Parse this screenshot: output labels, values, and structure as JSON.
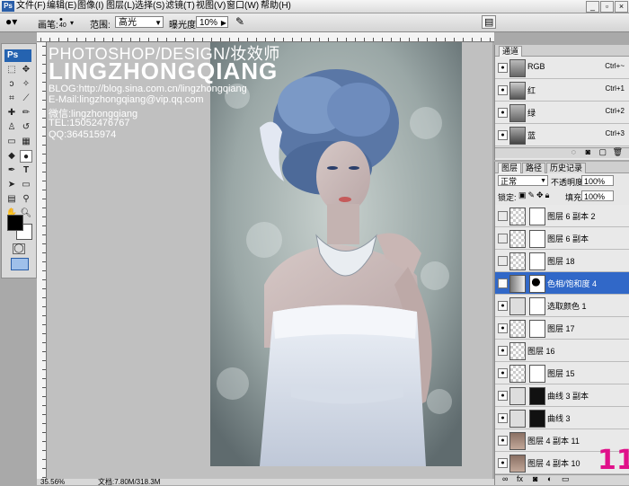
{
  "menubar": {
    "items": [
      "文件(F)",
      "编辑(E)",
      "图像(I)",
      "图层(L)",
      "选择(S)",
      "滤镜(T)",
      "视图(V)",
      "窗口(W)",
      "帮助(H)"
    ]
  },
  "options": {
    "brush_label": "画笔:",
    "brush_size": "40",
    "range_label": "范围:",
    "range_value": "高光",
    "exposure_label": "曝光度:",
    "exposure_value": "10%"
  },
  "overlay": {
    "line1": "PHOTOSHOP/DESIGN/妆效师",
    "line2": "LINGZHONGQIANG",
    "blog": "BLOG:http://blog.sina.com.cn/lingzhongqiang",
    "email": "E-Mail:lingzhongqiang@vip.qq.com",
    "wechat": "微信:lingzhongqiang",
    "tel": "TEL:15052476767",
    "qq": "QQ:364515974"
  },
  "status": {
    "zoom": "35.56%",
    "doc": "文档:7.80M/318.3M"
  },
  "channels": {
    "tab": "通道",
    "rows": [
      {
        "name": "RGB",
        "shortcut": "Ctrl+~"
      },
      {
        "name": "红",
        "shortcut": "Ctrl+1"
      },
      {
        "name": "绿",
        "shortcut": "Ctrl+2"
      },
      {
        "name": "蓝",
        "shortcut": "Ctrl+3"
      }
    ]
  },
  "layers": {
    "tabs": [
      "图层",
      "路径",
      "历史记录"
    ],
    "blend_mode": "正常",
    "opacity_label": "不透明度:",
    "opacity_value": "100%",
    "lock_label": "锁定:",
    "fill_label": "填充:",
    "fill_value": "100%",
    "rows": [
      {
        "name": "图层 6 副本 2"
      },
      {
        "name": "图层 6 副本"
      },
      {
        "name": "图层 18"
      },
      {
        "name": "色相/饱和度 4"
      },
      {
        "name": "选取颜色 1"
      },
      {
        "name": "图层 17"
      },
      {
        "name": "图层 16"
      },
      {
        "name": "图层 15"
      },
      {
        "name": "曲线 3 副本"
      },
      {
        "name": "曲线 3"
      },
      {
        "name": "图层 4 副本 11"
      },
      {
        "name": "图层 4 副本 10"
      }
    ]
  },
  "step_number": "11",
  "colors": {
    "selection": "#3168c8",
    "step": "#e0108a",
    "photoshop_blue": "#2563b0"
  }
}
